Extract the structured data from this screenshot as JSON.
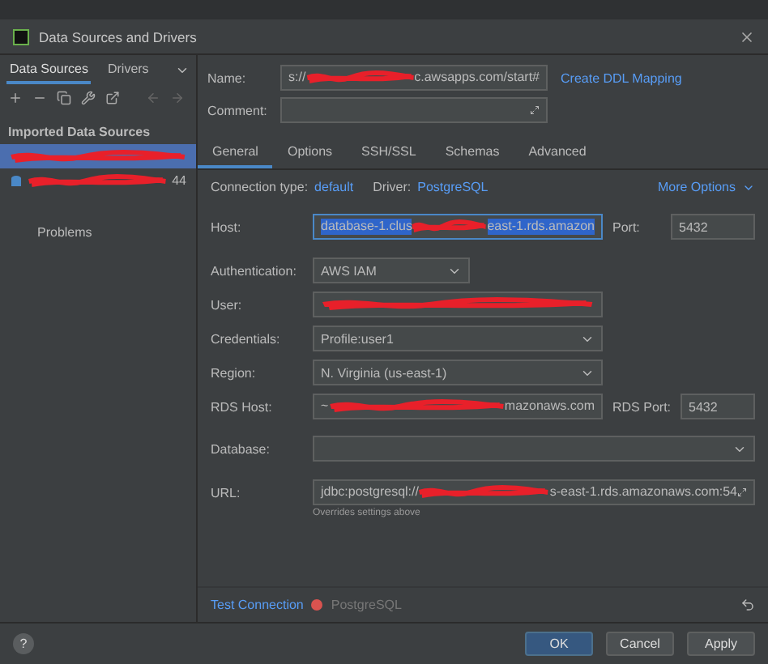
{
  "window": {
    "title": "Data Sources and Drivers"
  },
  "sidebar": {
    "tabs": [
      {
        "label": "Data Sources",
        "selected": true
      },
      {
        "label": "Drivers",
        "selected": false
      }
    ],
    "section": "Imported Data Sources",
    "items": [
      {
        "selected": true,
        "parts": [
          {
            "kind": "redacted"
          }
        ]
      },
      {
        "selected": false,
        "parts": [
          {
            "kind": "redacted"
          },
          {
            "kind": "text",
            "text": "44"
          }
        ]
      }
    ],
    "problems": "Problems"
  },
  "header": {
    "name_label": "Name:",
    "name_parts": [
      {
        "kind": "text",
        "text": "s://"
      },
      {
        "kind": "redacted"
      },
      {
        "kind": "text",
        "text": "c.awsapps.com/start#"
      }
    ],
    "ddl_link": "Create DDL Mapping",
    "comment_label": "Comment:"
  },
  "tabs": [
    {
      "label": "General",
      "selected": true
    },
    {
      "label": "Options",
      "selected": false
    },
    {
      "label": "SSH/SSL",
      "selected": false
    },
    {
      "label": "Schemas",
      "selected": false
    },
    {
      "label": "Advanced",
      "selected": false
    }
  ],
  "connection": {
    "type_label": "Connection type:",
    "type_value": "default",
    "driver_label": "Driver:",
    "driver_value": "PostgreSQL",
    "more": "More Options"
  },
  "fields": [
    {
      "kind": "field",
      "label": "Host:",
      "highlighted": true,
      "parts": [
        {
          "kind": "text",
          "text": "database-1.clus"
        },
        {
          "kind": "redacted"
        },
        {
          "kind": "text",
          "text": "east-1.rds.amazon"
        }
      ],
      "side_label": "Port:",
      "side_value": "5432"
    },
    {
      "kind": "select-short",
      "label": "Authentication:",
      "value": "AWS IAM"
    },
    {
      "kind": "field",
      "label": "User:",
      "highlighted": false,
      "parts": [
        {
          "kind": "redacted"
        }
      ]
    },
    {
      "kind": "select",
      "label": "Credentials:",
      "value": "Profile:user1"
    },
    {
      "kind": "select",
      "label": "Region:",
      "value": "N. Virginia (us-east-1)"
    },
    {
      "kind": "field",
      "label": "RDS Host:",
      "highlighted": false,
      "parts": [
        {
          "kind": "text",
          "text": "~"
        },
        {
          "kind": "redacted"
        },
        {
          "kind": "text",
          "text": "mazonaws.com"
        }
      ],
      "side_label": "RDS Port:",
      "side_value": "5432"
    },
    {
      "kind": "combo",
      "label": "Database:"
    },
    {
      "kind": "url",
      "label": "URL:",
      "parts": [
        {
          "kind": "text",
          "text": "jdbc:postgresql://"
        },
        {
          "kind": "redacted"
        },
        {
          "kind": "text",
          "text": "s-east-1.rds.amazonaws.com:54"
        }
      ],
      "hint": "Overrides settings above"
    }
  ],
  "test": {
    "link": "Test Connection",
    "driver": "PostgreSQL"
  },
  "help": "?",
  "buttons": [
    {
      "label": "OK",
      "primary": true
    },
    {
      "label": "Cancel",
      "primary": false
    },
    {
      "label": "Apply",
      "primary": false
    }
  ]
}
